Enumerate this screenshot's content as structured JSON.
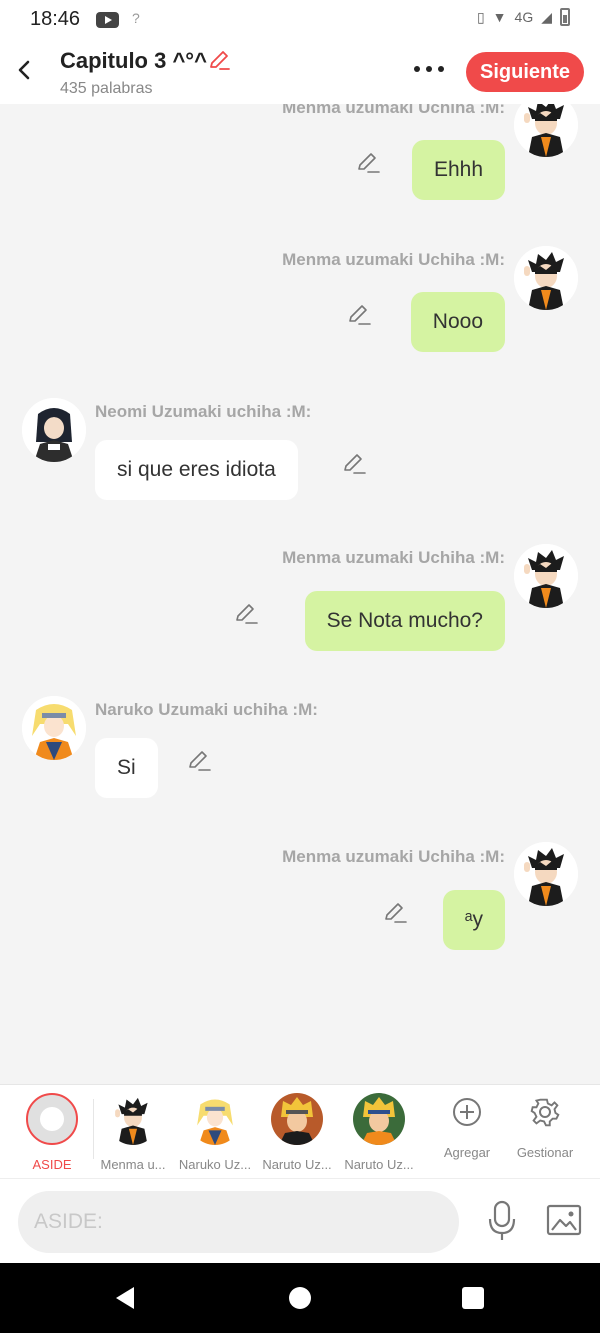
{
  "status": {
    "time": "18:46",
    "signal_text": "?",
    "network": "4G"
  },
  "header": {
    "title": "Capitulo 3 ^°^",
    "word_count": "435 palabras",
    "next_label": "Siguiente"
  },
  "messages": [
    {
      "side": "right",
      "sender": "Menma uzumaki Uchiha :M:",
      "text": "Ehhh",
      "avatar": "menma"
    },
    {
      "side": "right",
      "sender": "Menma uzumaki Uchiha :M:",
      "text": "Nooo",
      "avatar": "menma"
    },
    {
      "side": "left",
      "sender": "Neomi Uzumaki uchiha :M:",
      "text": "si que eres idiota",
      "avatar": "neomi"
    },
    {
      "side": "right",
      "sender": "Menma uzumaki Uchiha :M:",
      "text": "Se Nota mucho?",
      "avatar": "menma"
    },
    {
      "side": "left",
      "sender": "Naruko Uzumaki uchiha :M:",
      "text": "Si",
      "avatar": "naruko"
    },
    {
      "side": "right",
      "sender": "Menma uzumaki Uchiha :M:",
      "text": "ᵃy",
      "avatar": "menma"
    }
  ],
  "characters": [
    {
      "label": "ASIDE",
      "kind": "aside"
    },
    {
      "label": "Menma u...",
      "kind": "menma"
    },
    {
      "label": "Naruko Uz...",
      "kind": "naruko"
    },
    {
      "label": "Naruto Uz...",
      "kind": "naruto1"
    },
    {
      "label": "Naruto Uz...",
      "kind": "naruto2"
    }
  ],
  "actions": {
    "add_label": "Agregar",
    "manage_label": "Gestionar"
  },
  "input": {
    "placeholder": "ASIDE:"
  },
  "colors": {
    "accent": "#f04a4a",
    "bubble_right": "#d5f3a2",
    "bubble_left": "#ffffff"
  }
}
